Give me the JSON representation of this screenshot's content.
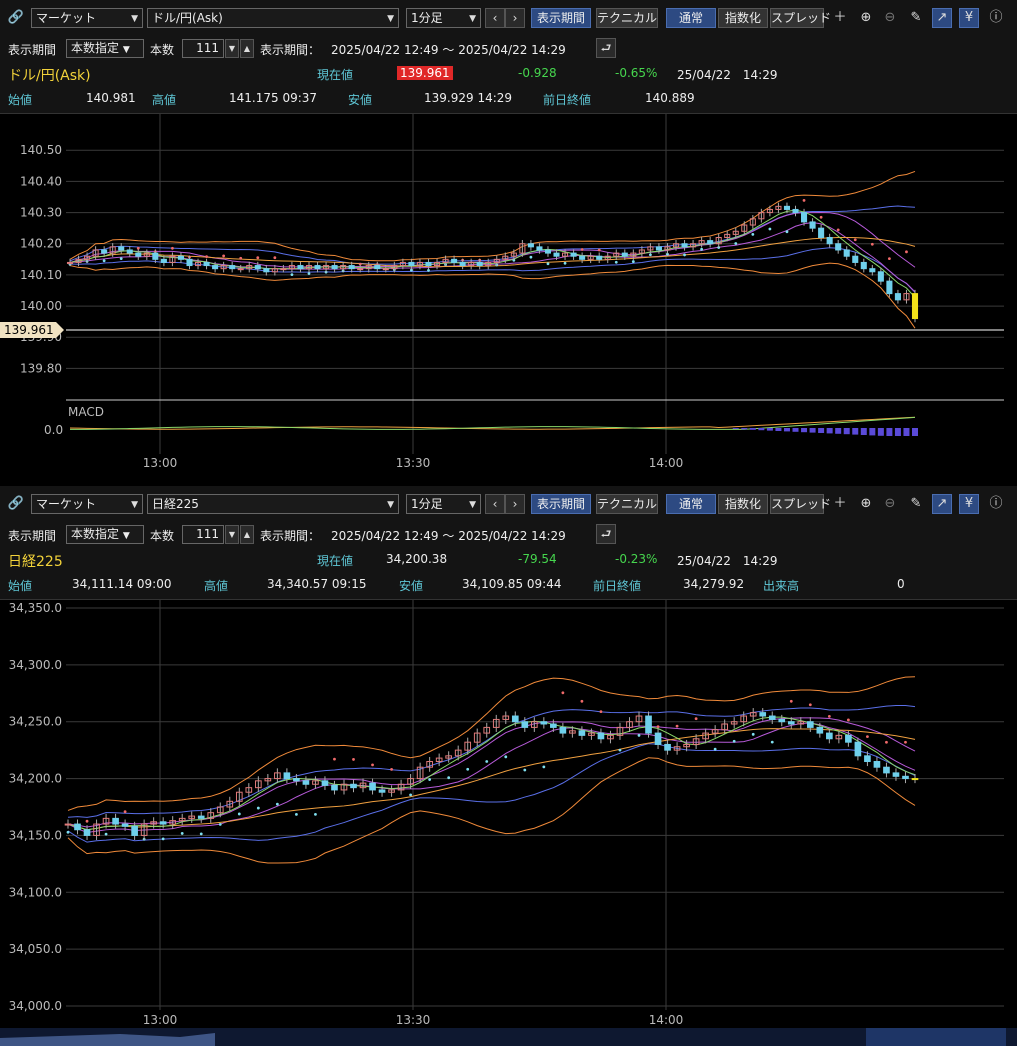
{
  "panels": [
    {
      "toolbar": {
        "market_dropdown": "マーケット",
        "symbol_dropdown": "ドル/円(Ask)",
        "interval_dropdown": "1分足",
        "btn_period": "表示期間",
        "btn_technical": "テクニカル",
        "btn_normal": "通常",
        "btn_index": "指数化",
        "btn_spread": "スプレッド"
      },
      "settings": {
        "period_label": "表示期間",
        "mode_dropdown": "本数指定",
        "count_label": "本数",
        "count_value": "111",
        "range_label": "表示期間：",
        "range_value": "2025/04/22 12:49 ～ 2025/04/22 14:29"
      },
      "quote": {
        "name": "ドル/円(Ask)",
        "current_label": "現在値",
        "current_value": "139.961",
        "change": "-0.928",
        "change_pct": "-0.65%",
        "datetime": "25/04/22　14:29"
      },
      "ohlc": {
        "open_label": "始値",
        "open_value": "140.981",
        "high_label": "高値",
        "high_value": "141.175 09:37",
        "low_label": "安値",
        "low_value": "139.929 14:29",
        "prev_label": "前日終値",
        "prev_value": "140.889"
      },
      "chart": {
        "y_ticks": [
          "140.50",
          "140.40",
          "140.30",
          "140.20",
          "140.10",
          "140.00",
          "139.90",
          "139.80"
        ],
        "price_tag": "139.961",
        "x_ticks": [
          "13:00",
          "13:30",
          "14:00"
        ],
        "macd_label": "MACD",
        "macd_tick": "0.0"
      }
    },
    {
      "toolbar": {
        "market_dropdown": "マーケット",
        "symbol_dropdown": "日経225",
        "interval_dropdown": "1分足",
        "btn_period": "表示期間",
        "btn_technical": "テクニカル",
        "btn_normal": "通常",
        "btn_index": "指数化",
        "btn_spread": "スプレッド"
      },
      "settings": {
        "period_label": "表示期間",
        "mode_dropdown": "本数指定",
        "count_label": "本数",
        "count_value": "111",
        "range_label": "表示期間：",
        "range_value": "2025/04/22 12:49 ～ 2025/04/22 14:29"
      },
      "quote": {
        "name": "日経225",
        "current_label": "現在値",
        "current_value": "34,200.38",
        "change": "-79.54",
        "change_pct": "-0.23%",
        "datetime": "25/04/22　14:29"
      },
      "ohlc": {
        "open_label": "始値",
        "open_value": "34,111.14 09:00",
        "high_label": "高値",
        "high_value": "34,340.57 09:15",
        "low_label": "安値",
        "low_value": "34,109.85 09:44",
        "prev_label": "前日終値",
        "prev_value": "34,279.92",
        "volume_label": "出来高",
        "volume_value": "0"
      },
      "chart": {
        "y_ticks": [
          "34,350.0",
          "34,300.0",
          "34,250.0",
          "34,200.0",
          "34,150.0",
          "34,100.0",
          "34,050.0",
          "34,000.0"
        ],
        "x_ticks": [
          "13:00",
          "13:30",
          "14:00"
        ]
      }
    }
  ],
  "chart_data": [
    {
      "type": "candlestick",
      "ylim": [
        139.75,
        140.52
      ],
      "x_ticks": [
        "13:00",
        "13:30",
        "14:00"
      ],
      "close": [
        140.14,
        140.15,
        140.16,
        140.18,
        140.17,
        140.19,
        140.18,
        140.17,
        140.16,
        140.17,
        140.15,
        140.14,
        140.16,
        140.15,
        140.13,
        140.14,
        140.13,
        140.12,
        140.13,
        140.12,
        140.12,
        140.13,
        140.12,
        140.11,
        140.12,
        140.12,
        140.13,
        140.12,
        140.13,
        140.12,
        140.13,
        140.12,
        140.13,
        140.12,
        140.12,
        140.13,
        140.12,
        140.12,
        140.13,
        140.14,
        140.13,
        140.14,
        140.13,
        140.14,
        140.15,
        140.14,
        140.13,
        140.14,
        140.13,
        140.14,
        140.15,
        140.16,
        140.17,
        140.2,
        140.19,
        140.18,
        140.17,
        140.16,
        140.17,
        140.16,
        140.15,
        140.16,
        140.15,
        140.16,
        140.17,
        140.16,
        140.17,
        140.18,
        140.19,
        140.18,
        140.19,
        140.2,
        140.19,
        140.2,
        140.21,
        140.2,
        140.22,
        140.23,
        140.24,
        140.26,
        140.28,
        140.3,
        140.31,
        140.32,
        140.31,
        140.3,
        140.27,
        140.25,
        140.22,
        140.2,
        140.18,
        140.16,
        140.14,
        140.12,
        140.11,
        140.08,
        140.04,
        140.02,
        140.04,
        139.96
      ]
    },
    {
      "type": "candlestick",
      "ylim": [
        34000,
        34350
      ],
      "x_ticks": [
        "13:00",
        "13:30",
        "14:00"
      ],
      "close": [
        34160,
        34155,
        34150,
        34160,
        34165,
        34160,
        34158,
        34150,
        34160,
        34162,
        34160,
        34163,
        34165,
        34167,
        34165,
        34170,
        34175,
        34180,
        34188,
        34192,
        34198,
        34200,
        34205,
        34200,
        34198,
        34195,
        34198,
        34194,
        34190,
        34195,
        34192,
        34196,
        34190,
        34188,
        34190,
        34195,
        34200,
        34210,
        34215,
        34218,
        34220,
        34225,
        34232,
        34240,
        34245,
        34252,
        34255,
        34250,
        34245,
        34250,
        34248,
        34245,
        34240,
        34242,
        34238,
        34240,
        34235,
        34238,
        34245,
        34250,
        34255,
        34240,
        34230,
        34225,
        34228,
        34230,
        34235,
        34240,
        34243,
        34248,
        34250,
        34255,
        34258,
        34255,
        34252,
        34250,
        34248,
        34250,
        34245,
        34240,
        34235,
        34238,
        34232,
        34220,
        34215,
        34210,
        34205,
        34202,
        34200,
        34200
      ]
    }
  ]
}
